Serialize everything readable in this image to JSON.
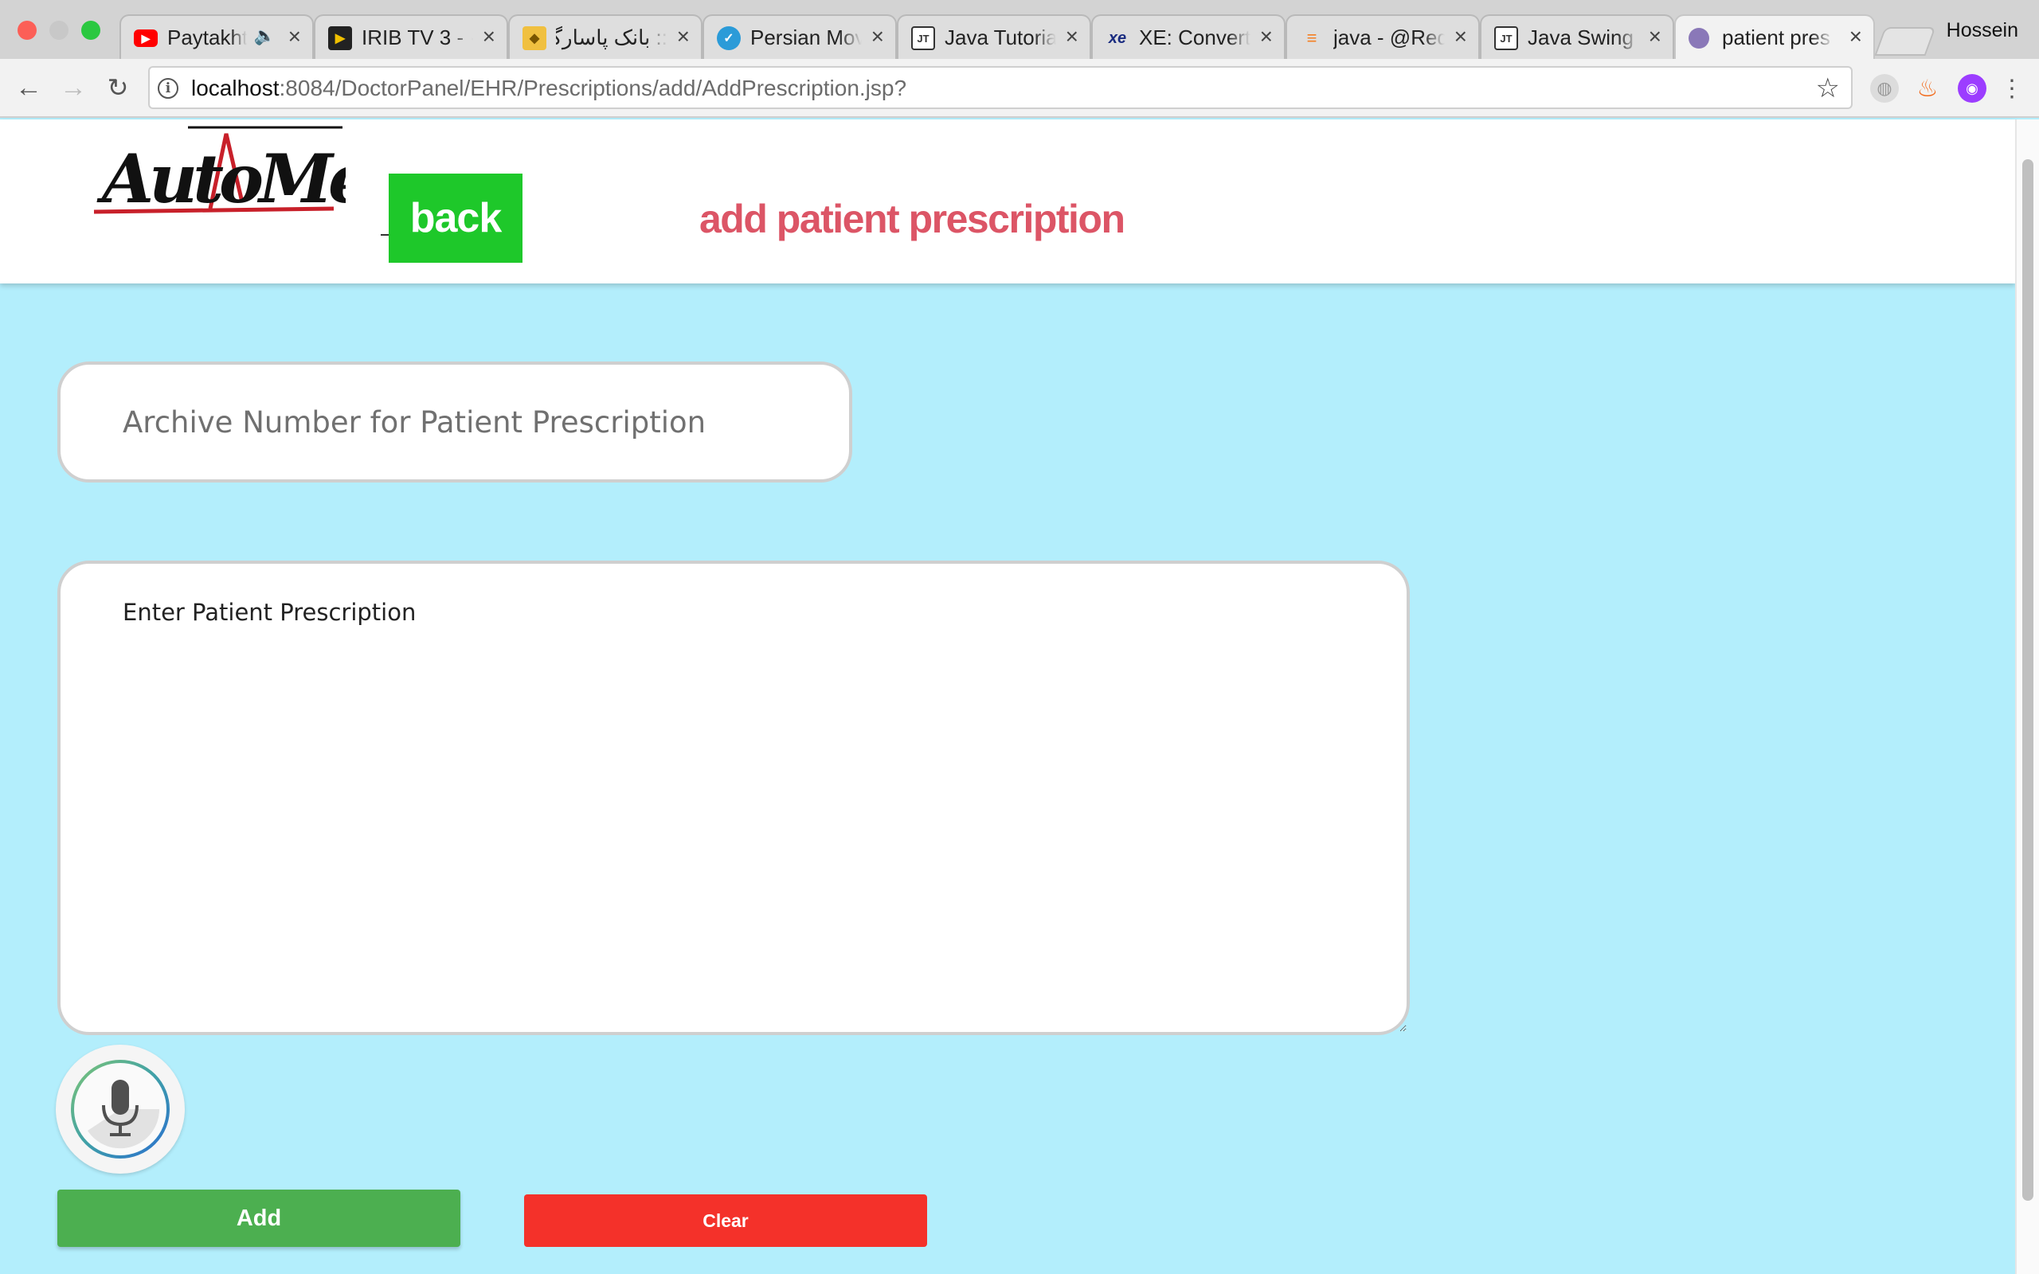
{
  "browser": {
    "tabs": [
      {
        "title": "Paytakht",
        "icon": "youtube-icon",
        "audio": true
      },
      {
        "title": "IRIB TV 3 - ·",
        "icon": "play-icon"
      },
      {
        "title": ":: بانک پاسارگاد",
        "icon": "bank-icon"
      },
      {
        "title": "Persian Mov",
        "icon": "globe-icon"
      },
      {
        "title": "Java Tutoria",
        "icon": "jt-icon"
      },
      {
        "title": "XE: Convert",
        "icon": "xe-icon"
      },
      {
        "title": "java - @Req",
        "icon": "stackoverflow-icon"
      },
      {
        "title": "Java Swing",
        "icon": "jt-icon"
      },
      {
        "title": "patient pres",
        "icon": "avatar-icon",
        "active": true
      }
    ],
    "profile_name": "Hossein",
    "url_host": "localhost",
    "url_path": ":8084/DoctorPanel/EHR/Prescriptions/add/AddPrescription.jsp?"
  },
  "header": {
    "logo_text": "AutoMed",
    "back_label": "back",
    "title": "add patient prescription"
  },
  "form": {
    "archive_placeholder": "Archive Number for Patient Prescription",
    "archive_value": "",
    "prescription_placeholder": "Enter Patient Prescription",
    "prescription_value": "",
    "add_label": "Add",
    "clear_label": "Clear"
  },
  "colors": {
    "page_bg": "#b3eefc",
    "back_button": "#1ec82a",
    "title": "#dc5566",
    "add_button": "#4caf50",
    "clear_button": "#f4312a"
  }
}
